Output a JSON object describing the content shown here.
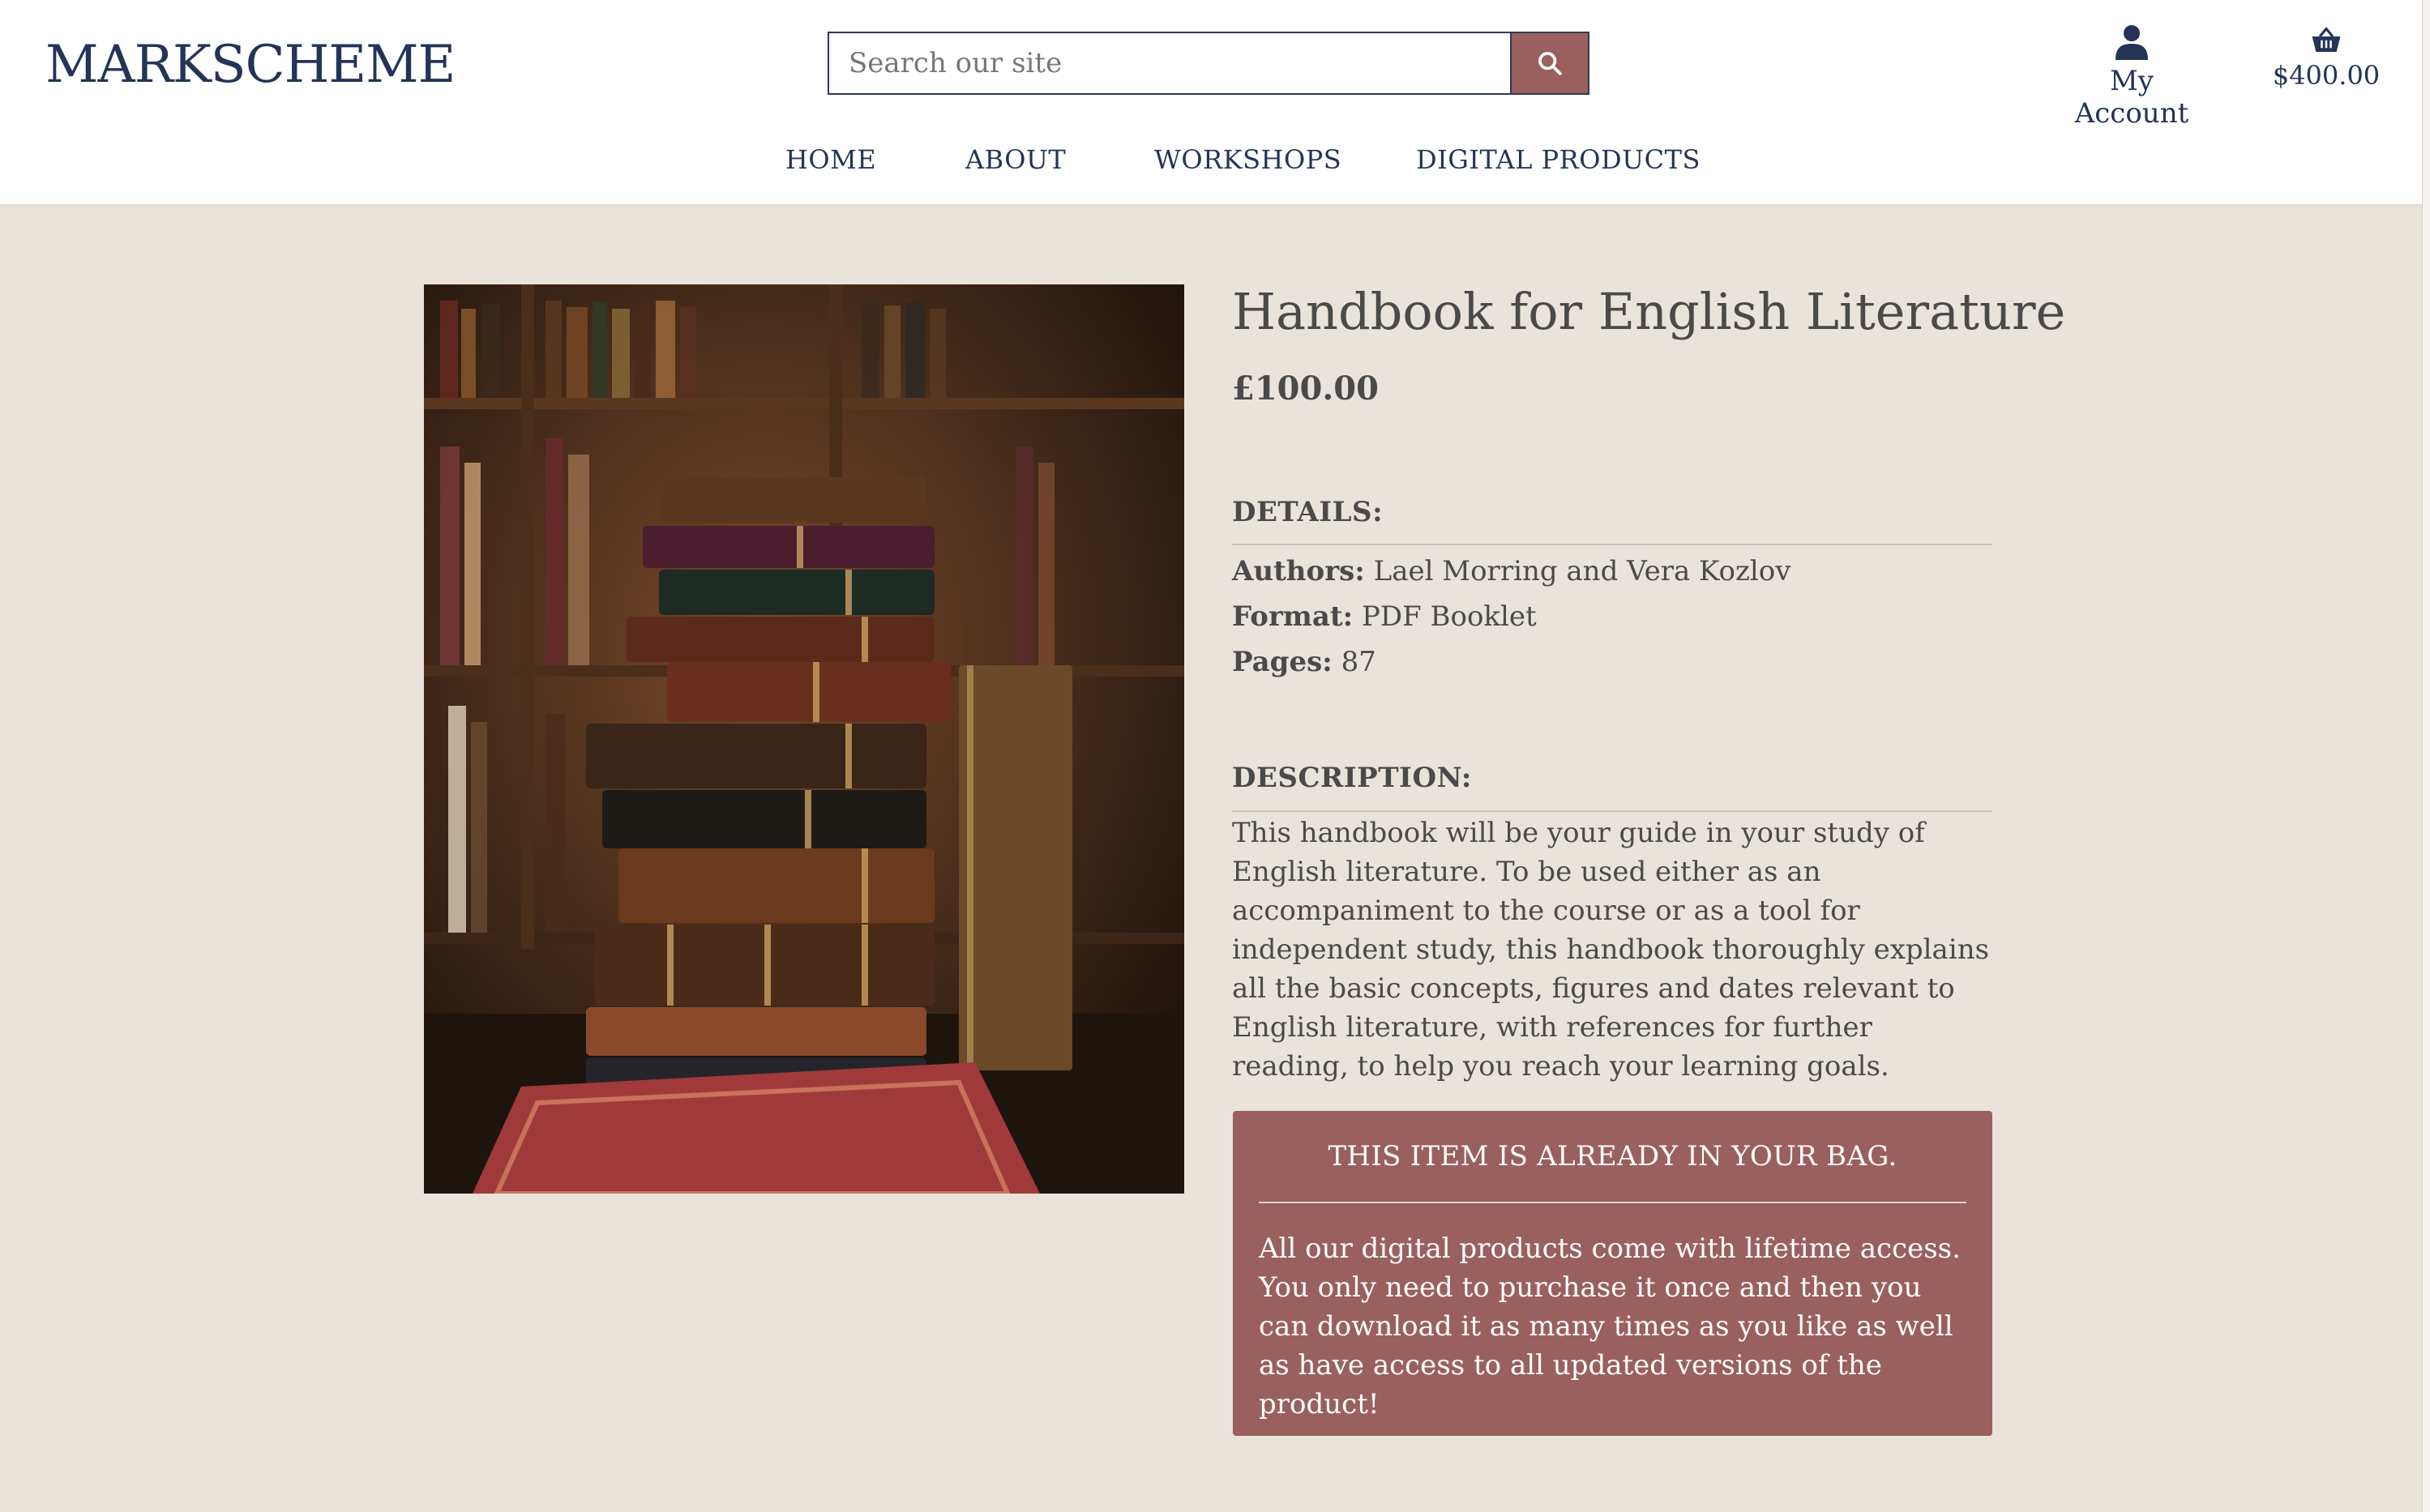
{
  "brand": {
    "logo_text": "MARKSCHEME"
  },
  "search": {
    "placeholder": "Search our site",
    "button_icon": "search-icon"
  },
  "account": {
    "label": "My Account",
    "icon": "user-icon"
  },
  "bag": {
    "total": "$400.00",
    "icon": "basket-icon"
  },
  "nav": {
    "items": [
      {
        "label": "HOME"
      },
      {
        "label": "ABOUT"
      },
      {
        "label": "WORKSHOPS"
      },
      {
        "label": "DIGITAL PRODUCTS"
      }
    ]
  },
  "product": {
    "title": "Handbook for English Literature",
    "price": "£100.00",
    "details_heading": "DETAILS:",
    "details": [
      {
        "label": "Authors:",
        "value": "Lael Morring and Vera Kozlov"
      },
      {
        "label": "Format:",
        "value": "PDF Booklet"
      },
      {
        "label": "Pages:",
        "value": "87"
      }
    ],
    "description_heading": "DESCRIPTION:",
    "description": "This handbook will be your guide in your study of English literature. To be used either as an accompaniment to the course or as a tool for independent study, this handbook thoroughly explains all the basic concepts, figures and dates relevant to English literature, with references for further reading, to help you reach your learning goals.",
    "image_alt": "stack of antique leather-bound books"
  },
  "bag_notice": {
    "heading": "THIS ITEM IS ALREADY IN YOUR BAG.",
    "body": "All our digital products come with lifetime access. You only need to purchase it once and then you can download it as many times as you like as well as have access to all updated versions of the product!"
  },
  "colors": {
    "navy": "#233457",
    "rose": "#9a605d",
    "background": "#e9e3dc",
    "text": "#4a4a4a"
  }
}
